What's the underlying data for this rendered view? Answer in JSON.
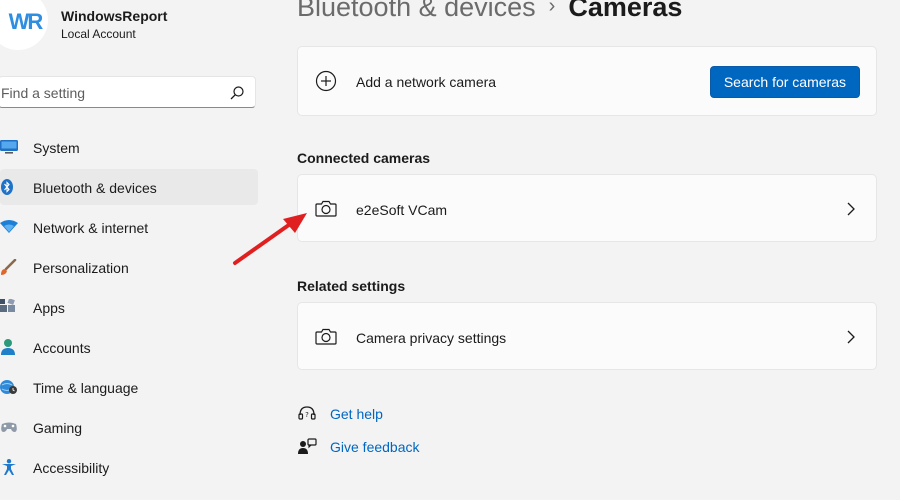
{
  "profile": {
    "logo_text": "WR",
    "name": "WindowsReport",
    "account_type": "Local Account"
  },
  "search": {
    "placeholder": "Find a setting",
    "icon": "search-icon"
  },
  "nav": {
    "items": [
      {
        "label": "System",
        "icon": "monitor-icon",
        "active": false
      },
      {
        "label": "Bluetooth & devices",
        "icon": "bluetooth-icon",
        "active": true
      },
      {
        "label": "Network & internet",
        "icon": "wifi-icon",
        "active": false
      },
      {
        "label": "Personalization",
        "icon": "brush-icon",
        "active": false
      },
      {
        "label": "Apps",
        "icon": "apps-icon",
        "active": false
      },
      {
        "label": "Accounts",
        "icon": "person-icon",
        "active": false
      },
      {
        "label": "Time & language",
        "icon": "globe-clock-icon",
        "active": false
      },
      {
        "label": "Gaming",
        "icon": "gamepad-icon",
        "active": false
      },
      {
        "label": "Accessibility",
        "icon": "accessibility-icon",
        "active": false
      }
    ]
  },
  "breadcrumb": {
    "parent": "Bluetooth & devices",
    "separator": "›",
    "current": "Cameras"
  },
  "add_camera": {
    "label": "Add a network camera",
    "button": "Search for cameras",
    "icon": "plus-circle-icon"
  },
  "connected": {
    "title": "Connected cameras",
    "cameras": [
      {
        "name": "e2eSoft VCam",
        "icon": "camera-icon"
      }
    ]
  },
  "related": {
    "title": "Related settings",
    "items": [
      {
        "label": "Camera privacy settings",
        "icon": "camera-icon"
      }
    ]
  },
  "help": {
    "get_help": "Get help",
    "give_feedback": "Give feedback"
  },
  "colors": {
    "accent": "#0067c0",
    "background": "#f3f3f3",
    "card": "#fbfbfb",
    "annotation_arrow": "#e02020"
  }
}
